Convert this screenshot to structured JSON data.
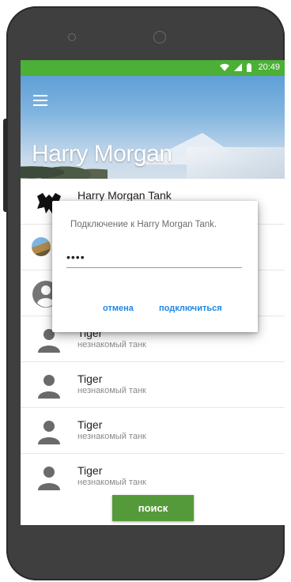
{
  "status_bar": {
    "time": "20:49",
    "icons": [
      "wifi-icon",
      "signal-icon",
      "battery-icon"
    ],
    "color": "#4caf37"
  },
  "header": {
    "title": "Harry Morgan",
    "menu_icon": "hamburger-menu-icon"
  },
  "list": [
    {
      "name": "Harry Morgan Tank",
      "subtitle": "",
      "icon": "tank-logo-icon"
    },
    {
      "name": "",
      "subtitle": "",
      "icon": "photo-thumbnail-icon"
    },
    {
      "name": "",
      "subtitle": "",
      "icon": "person-circle-icon"
    },
    {
      "name": "Tiger",
      "subtitle": "незнакомый танк",
      "icon": "person-icon"
    },
    {
      "name": "Tiger",
      "subtitle": "незнакомый танк",
      "icon": "person-icon"
    },
    {
      "name": "Tiger",
      "subtitle": "незнакомый танк",
      "icon": "person-icon"
    },
    {
      "name": "Tiger",
      "subtitle": "незнакомый танк",
      "icon": "person-icon"
    }
  ],
  "search_button": {
    "label": "поиск",
    "color": "#559a3a"
  },
  "dialog": {
    "message": "Подключение к Harry Morgan Tank.",
    "password_value": "••••",
    "cancel_label": "отмена",
    "connect_label": "подключиться",
    "accent_color": "#1e88e5"
  }
}
